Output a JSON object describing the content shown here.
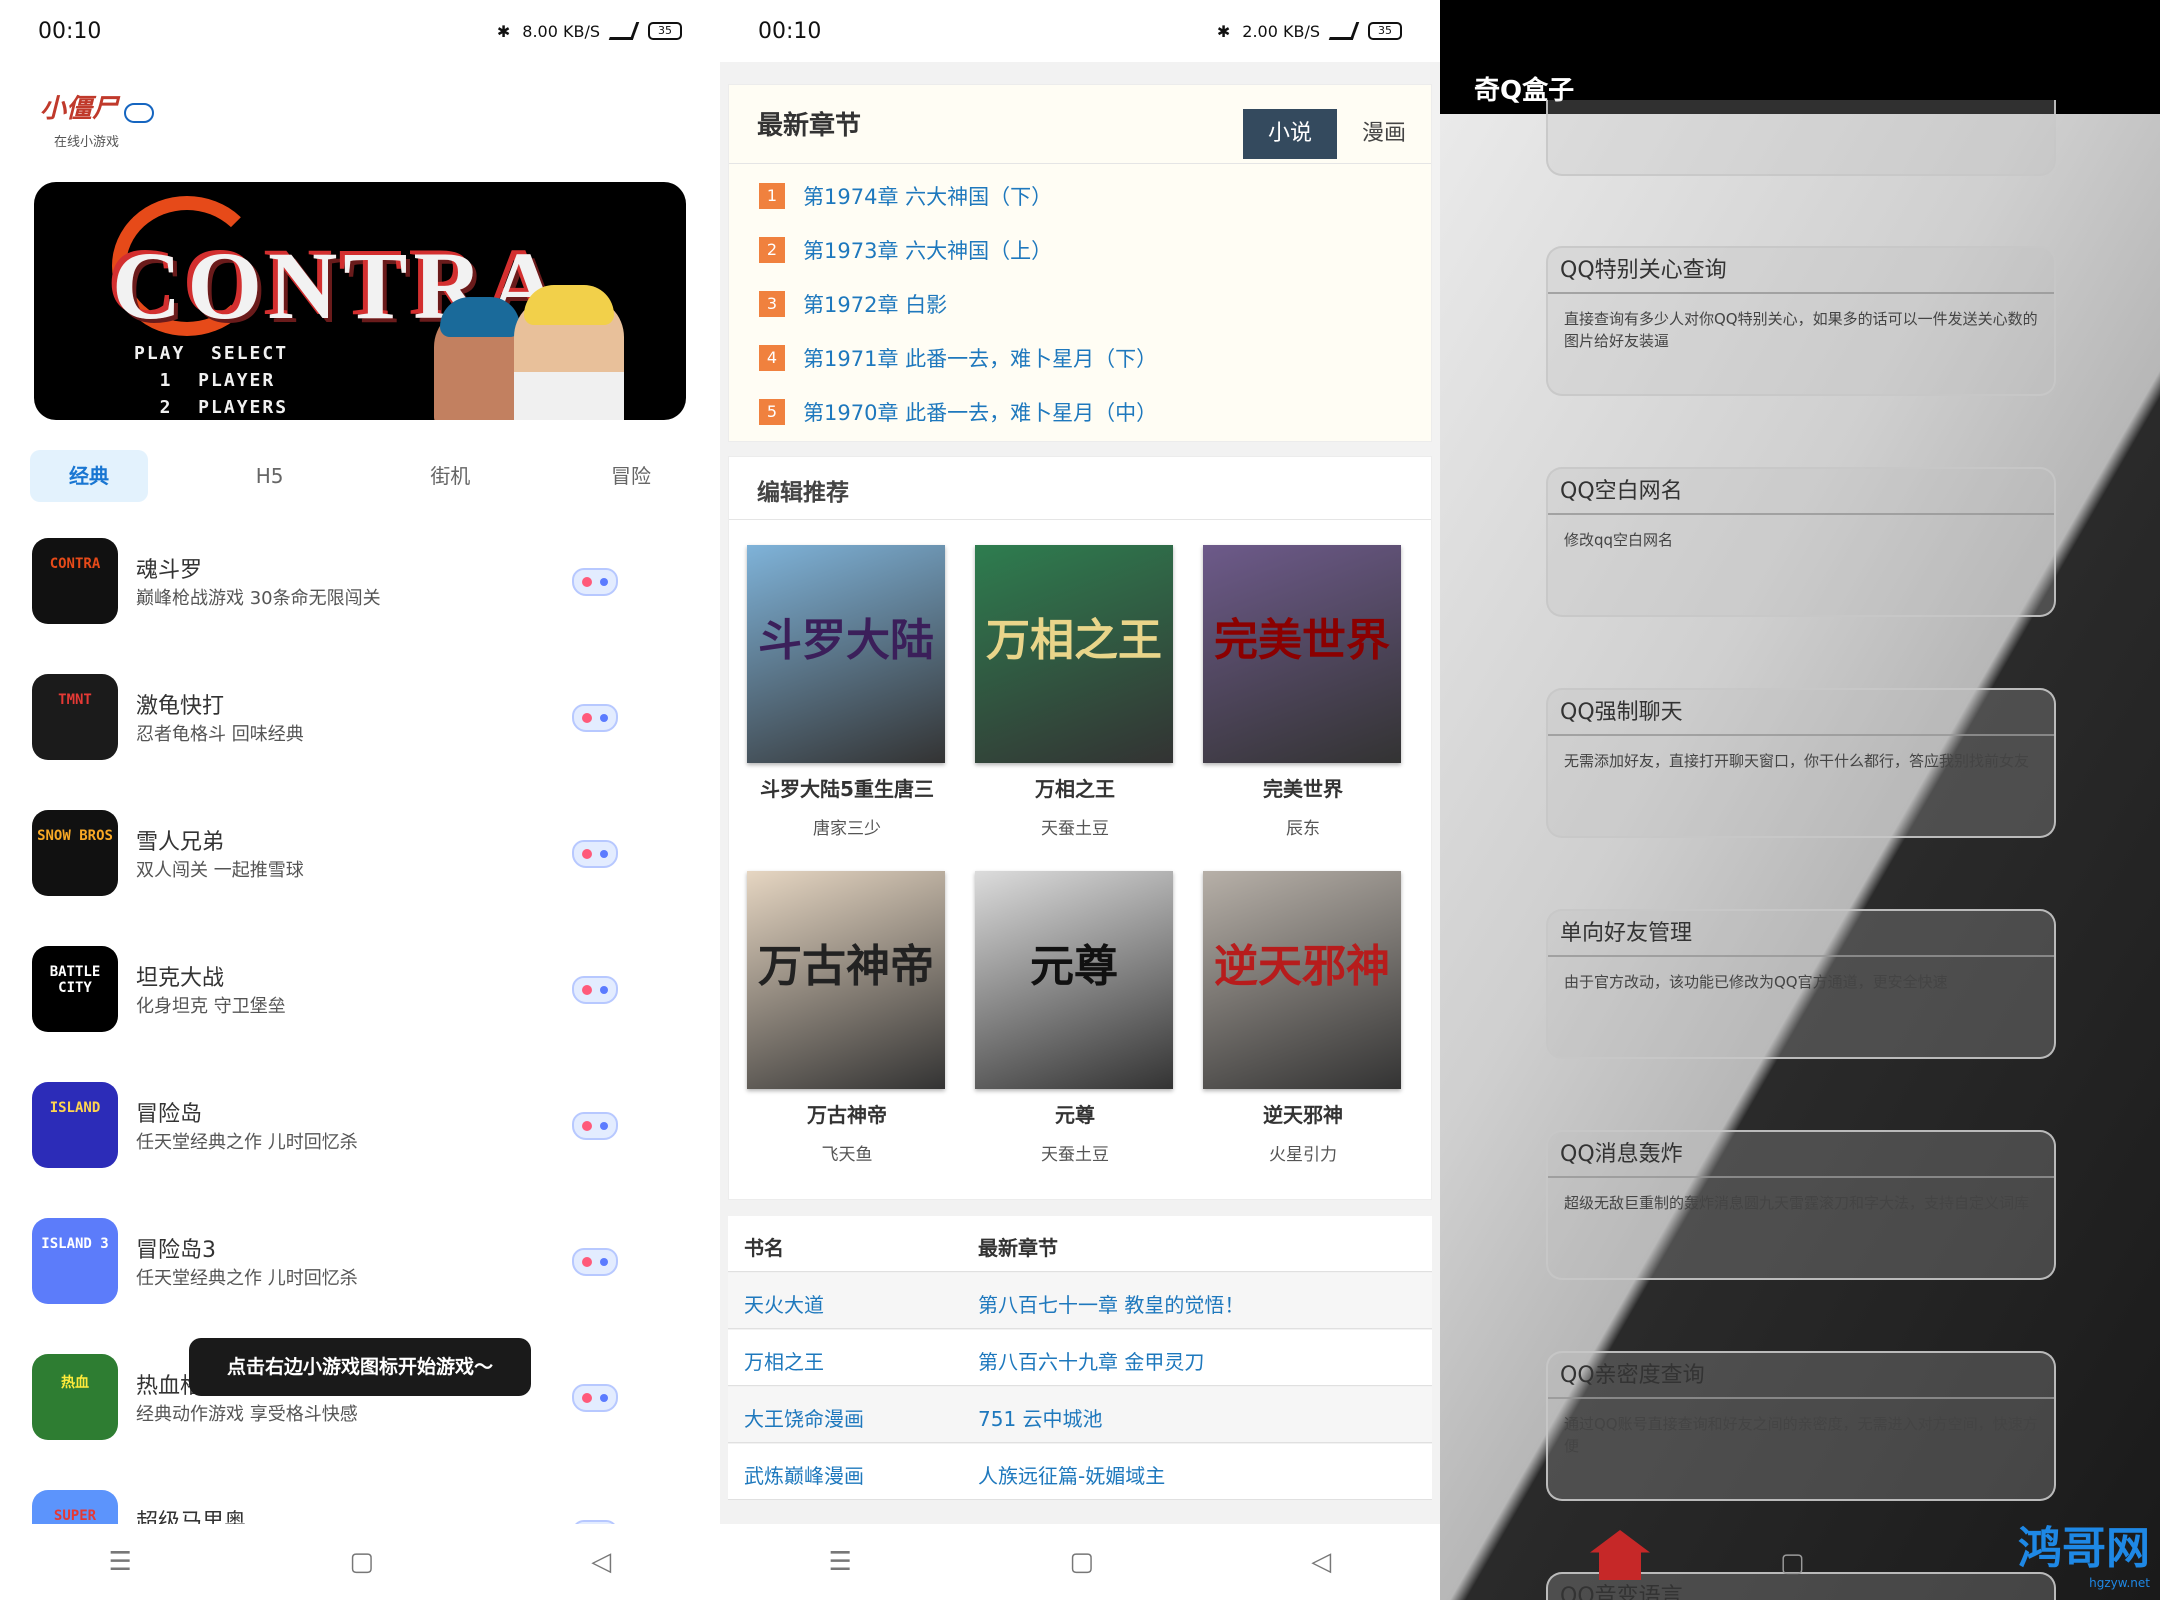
{
  "panel1": {
    "status": {
      "time": "00:10",
      "speed": "8.00 KB/S",
      "battery": "35"
    },
    "logo": {
      "title": "小僵尸",
      "subtitle": "在线小游戏"
    },
    "banner": {
      "title": "CONTRA",
      "menu": "PLAY  SELECT\n  1  PLAYER\n  2  PLAYERS"
    },
    "tabs": [
      "经典",
      "H5",
      "街机",
      "冒险"
    ],
    "games": [
      {
        "name": "魂斗罗",
        "desc": "巅峰枪战游戏 30条命无限闯关",
        "icon_text": "CONTRA",
        "icon_bg": "#111111",
        "icon_fg": "#e64a19"
      },
      {
        "name": "激龟快打",
        "desc": "忍者龟格斗 回味经典",
        "icon_text": "TMNT",
        "icon_bg": "#1b1b1b",
        "icon_fg": "#e53935"
      },
      {
        "name": "雪人兄弟",
        "desc": "双人闯关 一起推雪球",
        "icon_text": "SNOW BROS",
        "icon_bg": "#111111",
        "icon_fg": "#f9a825"
      },
      {
        "name": "坦克大战",
        "desc": "化身坦克 守卫堡垒",
        "icon_text": "BATTLE CITY",
        "icon_bg": "#000000",
        "icon_fg": "#ffffff"
      },
      {
        "name": "冒险岛",
        "desc": "任天堂经典之作 儿时回忆杀",
        "icon_text": "ISLAND",
        "icon_bg": "#2c2cb8",
        "icon_fg": "#ffd54f"
      },
      {
        "name": "冒险岛3",
        "desc": "任天堂经典之作 儿时回忆杀",
        "icon_text": "ISLAND 3",
        "icon_bg": "#5c7cfa",
        "icon_fg": "#ffffff"
      },
      {
        "name": "热血格斗",
        "desc": "经典动作游戏 享受格斗快感",
        "icon_text": "热血",
        "icon_bg": "#2e7d32",
        "icon_fg": "#ffeb3b"
      },
      {
        "name": "超级马里奥",
        "desc": "",
        "icon_text": "SUPER MARIO",
        "icon_bg": "#5c94fc",
        "icon_fg": "#e53935"
      }
    ],
    "toast": "点击右边小游戏图标开始游戏～",
    "nav": [
      "☰",
      "▢",
      "◁"
    ]
  },
  "panel2": {
    "status": {
      "time": "00:10",
      "speed": "2.00 KB/S",
      "battery": "35"
    },
    "latest": {
      "title": "最新章节",
      "tabs": [
        "小说",
        "漫画"
      ],
      "chapters": [
        {
          "n": "1",
          "text": "第1974章 六大神国（下）"
        },
        {
          "n": "2",
          "text": "第1973章 六大神国（上）"
        },
        {
          "n": "3",
          "text": "第1972章 白影"
        },
        {
          "n": "4",
          "text": "第1971章 此番一去，难卜星月（下）"
        },
        {
          "n": "5",
          "text": "第1970章 此番一去，难卜星月（中）"
        }
      ]
    },
    "recommend": {
      "title": "编辑推荐",
      "books": [
        {
          "name": "斗罗大陆5重生唐三",
          "author": "唐家三少",
          "cover_text": "斗罗大陆",
          "bg": "#7fb3d9",
          "fg": "#3b1f5a"
        },
        {
          "name": "万相之王",
          "author": "天蚕土豆",
          "cover_text": "万相之王",
          "bg": "#2e7d4f",
          "fg": "#e9d58a"
        },
        {
          "name": "完美世界",
          "author": "辰东",
          "cover_text": "完美世界",
          "bg": "#6d5a8a",
          "fg": "#8b0000"
        },
        {
          "name": "万古神帝",
          "author": "飞天鱼",
          "cover_text": "万古神帝",
          "bg": "#e6d6c2",
          "fg": "#222222"
        },
        {
          "name": "元尊",
          "author": "天蚕土豆",
          "cover_text": "元尊",
          "bg": "#dcdcdc",
          "fg": "#111111"
        },
        {
          "name": "逆天邪神",
          "author": "火星引力",
          "cover_text": "逆天邪神",
          "bg": "#b7b0a8",
          "fg": "#b71c1c"
        }
      ]
    },
    "table": {
      "headers": [
        "书名",
        "最新章节"
      ],
      "rows": [
        [
          "天火大道",
          "第八百七十一章 教皇的觉悟！"
        ],
        [
          "万相之王",
          "第八百六十九章 金甲灵刀"
        ],
        [
          "大王饶命漫画",
          "751 云中城池"
        ],
        [
          "武炼巅峰漫画",
          "人族远征篇-妩媚域主"
        ]
      ]
    },
    "nav": [
      "☰",
      "▢",
      "◁"
    ]
  },
  "panel3": {
    "title": "奇Q盒子",
    "features": [
      {
        "title": "QQ特别关心查询",
        "desc": "直接查询有多少人对你QQ特别关心，如果多的话可以一件发送关心数的图片给好友装逼"
      },
      {
        "title": "QQ空白网名",
        "desc": "修改qq空白网名"
      },
      {
        "title": "QQ强制聊天",
        "desc": "无需添加好友，直接打开聊天窗口，你干什么都行，答应我别找前女友"
      },
      {
        "title": "单向好友管理",
        "desc": "由于官方改动，该功能已修改为QQ官方通道，更安全快速"
      },
      {
        "title": "QQ消息轰炸",
        "desc": "超级无敌巨重制的轰炸消息圆九天雷霆滚刀和字大法，支持自定义词库"
      },
      {
        "title": "QQ亲密度查询",
        "desc": "通过QQ账号直接查询和好友之间的亲密度，无需进入对方空间，快速方便"
      },
      {
        "title": "QQ音变语言",
        "desc": ""
      }
    ],
    "watermark": {
      "name": "鸿哥网",
      "url": "hgzyw.net"
    },
    "nav": [
      "▢"
    ]
  }
}
